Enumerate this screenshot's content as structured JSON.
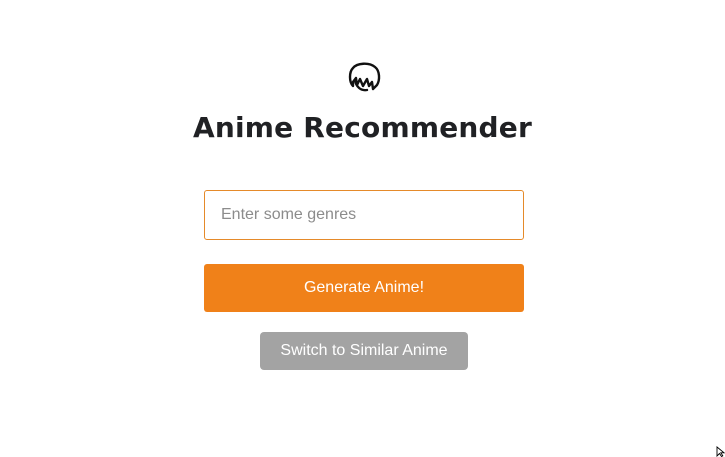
{
  "header": {
    "logo_icon": "anime-head-icon",
    "title": "Anime Recommender"
  },
  "form": {
    "genre_input": {
      "placeholder": "Enter some genres",
      "value": ""
    },
    "generate_label": "Generate Anime!",
    "switch_label": "Switch to Similar Anime"
  },
  "colors": {
    "accent": "#f08119",
    "input_border": "#e58a2a",
    "secondary_button": "#a3a3a3",
    "title_text": "#202124"
  }
}
